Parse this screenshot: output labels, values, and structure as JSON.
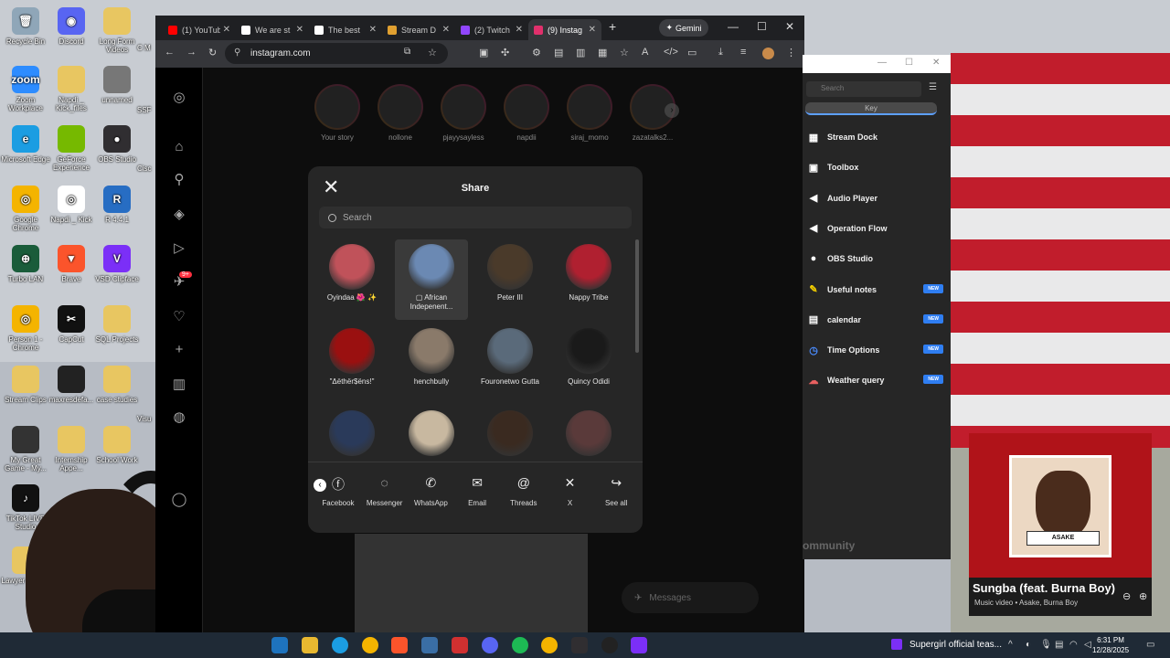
{
  "desktop": {
    "icons": [
      {
        "label": "Recycle Bin",
        "color": "#8fa6b8",
        "glyph": "🗑"
      },
      {
        "label": "Discord",
        "color": "#5865f2",
        "glyph": "◉"
      },
      {
        "label": "Long Form Videos",
        "color": "#e8c661",
        "glyph": ""
      },
      {
        "label": "Zoom Workplace",
        "color": "#2d8cff",
        "glyph": "zoom"
      },
      {
        "label": "Napdi _ Kick_files",
        "color": "#e8c661",
        "glyph": ""
      },
      {
        "label": "unnamed",
        "color": "#777777",
        "glyph": ""
      },
      {
        "label": "Microsoft Edge",
        "color": "#1b9de2",
        "glyph": "e"
      },
      {
        "label": "GeForce Experience",
        "color": "#76b900",
        "glyph": ""
      },
      {
        "label": "OBS Studio",
        "color": "#302e31",
        "glyph": "●"
      },
      {
        "label": "Google Chrome",
        "color": "#f4b400",
        "glyph": "◎"
      },
      {
        "label": "Napdi _ Kick",
        "color": "#ffffff",
        "glyph": "◎"
      },
      {
        "label": "R 4.4.1",
        "color": "#276dc3",
        "glyph": "R"
      },
      {
        "label": "Turbo LAN",
        "color": "#1a5c3a",
        "glyph": "⊕"
      },
      {
        "label": "Brave",
        "color": "#fb542b",
        "glyph": "▼"
      },
      {
        "label": "VSD Clipface",
        "color": "#7b2ff7",
        "glyph": "V"
      },
      {
        "label": "Person 1 - Chrome",
        "color": "#f4b400",
        "glyph": "◎"
      },
      {
        "label": "CapCut",
        "color": "#111111",
        "glyph": "✂"
      },
      {
        "label": "SQL Projects",
        "color": "#e8c661",
        "glyph": ""
      },
      {
        "label": "Stream Clips",
        "color": "#e8c661",
        "glyph": ""
      },
      {
        "label": "maxresdefa...",
        "color": "#222222",
        "glyph": ""
      },
      {
        "label": "case studies",
        "color": "#e8c661",
        "glyph": ""
      },
      {
        "label": "My Great Game - My...",
        "color": "#333333",
        "glyph": ""
      },
      {
        "label": "Internship Appe...",
        "color": "#e8c661",
        "glyph": ""
      },
      {
        "label": "School Work",
        "color": "#e8c661",
        "glyph": ""
      },
      {
        "label": "TikTok LIVE Studio",
        "color": "#111111",
        "glyph": "♪"
      },
      {
        "label": "Lawyer Project",
        "color": "#e8c661",
        "glyph": ""
      }
    ],
    "partial_labels": [
      "C M",
      "SSF",
      "Cisc",
      "Visu"
    ]
  },
  "browser": {
    "tabs": [
      {
        "label": "(1) YouTube",
        "color": "#ff0000",
        "active": false
      },
      {
        "label": "We are st",
        "color": "#ffffff",
        "active": false
      },
      {
        "label": "The best",
        "color": "#ffffff",
        "active": false
      },
      {
        "label": "Stream D",
        "color": "#e0a030",
        "active": false
      },
      {
        "label": "(2) Twitch",
        "color": "#9146ff",
        "active": false
      },
      {
        "label": "(9) Instag",
        "color": "#e1306c",
        "active": true
      }
    ],
    "new_tab": "+",
    "gemini": "Gemini",
    "url": "instagram.com",
    "controls": {
      "min": "—",
      "max": "☐",
      "close": "✕"
    }
  },
  "instagram": {
    "stories": [
      {
        "name": "Your story"
      },
      {
        "name": "nollone"
      },
      {
        "name": "pjayysayless"
      },
      {
        "name": "napdii"
      },
      {
        "name": "siraj_momo"
      },
      {
        "name": "zazatalks2..."
      }
    ],
    "share": {
      "title": "Share",
      "search_placeholder": "Search",
      "people": [
        {
          "name": "Oyindaa 🌺 ✨",
          "color": "#c0525a",
          "selected": false
        },
        {
          "name": "▢ African Indepenent...",
          "color": "#6b89b3",
          "selected": true
        },
        {
          "name": "Peter III",
          "color": "#4a3a2a",
          "selected": false
        },
        {
          "name": "Nappy Tribe",
          "color": "#b02030",
          "selected": false
        },
        {
          "name": "\"Δëthër$ëns!\"",
          "color": "#9a1010",
          "selected": false
        },
        {
          "name": "henchbully",
          "color": "#8a7a6a",
          "selected": false
        },
        {
          "name": "Fouronetwo Gutta",
          "color": "#5a6a7a",
          "selected": false
        },
        {
          "name": "Quincy Odidi",
          "color": "#1a1a1a",
          "selected": false
        },
        {
          "name": "",
          "color": "#2a3a5a",
          "selected": false
        },
        {
          "name": "",
          "color": "#c8b8a0",
          "selected": false
        },
        {
          "name": "",
          "color": "#3a2a20",
          "selected": false
        },
        {
          "name": "",
          "color": "#5a3a3a",
          "selected": false
        }
      ],
      "targets": [
        {
          "label": "Facebook",
          "glyph": "ⓕ"
        },
        {
          "label": "Messenger",
          "glyph": "◌"
        },
        {
          "label": "WhatsApp",
          "glyph": "✆"
        },
        {
          "label": "Email",
          "glyph": "✉"
        },
        {
          "label": "Threads",
          "glyph": "@"
        },
        {
          "label": "X",
          "glyph": "✕"
        },
        {
          "label": "See all",
          "glyph": "↪"
        }
      ]
    },
    "messages_label": "Messages",
    "notif_count": "9+"
  },
  "stream_dock": {
    "search_placeholder": "Search",
    "key_tab": "Key",
    "items": [
      {
        "label": "Stream Dock",
        "icon": "▦",
        "color": "#ffffff",
        "new": false
      },
      {
        "label": "Toolbox",
        "icon": "▣",
        "color": "#ffffff",
        "new": false
      },
      {
        "label": "Audio Player",
        "icon": "◀",
        "color": "#ffffff",
        "new": false
      },
      {
        "label": "Operation Flow",
        "icon": "◀",
        "color": "#ffffff",
        "new": false
      },
      {
        "label": "OBS Studio",
        "icon": "●",
        "color": "#ffffff",
        "new": false
      },
      {
        "label": "Useful notes",
        "icon": "✎",
        "color": "#f5d000",
        "new": true
      },
      {
        "label": "calendar",
        "icon": "▤",
        "color": "#ffffff",
        "new": true
      },
      {
        "label": "Time Options",
        "icon": "◷",
        "color": "#4a8cff",
        "new": true
      },
      {
        "label": "Weather query",
        "icon": "☁",
        "color": "#e86060",
        "new": true
      }
    ],
    "new_badge": "NEW",
    "community": "ommunity"
  },
  "music": {
    "title": "Sungba (feat. Burna Boy)",
    "subtitle": "Music video • Asake, Burna Boy",
    "plate_text": "ASAKE"
  },
  "taskbar": {
    "media_title": "Supergirl official teas...",
    "time": "6:31 PM",
    "date": "12/28/2025"
  }
}
